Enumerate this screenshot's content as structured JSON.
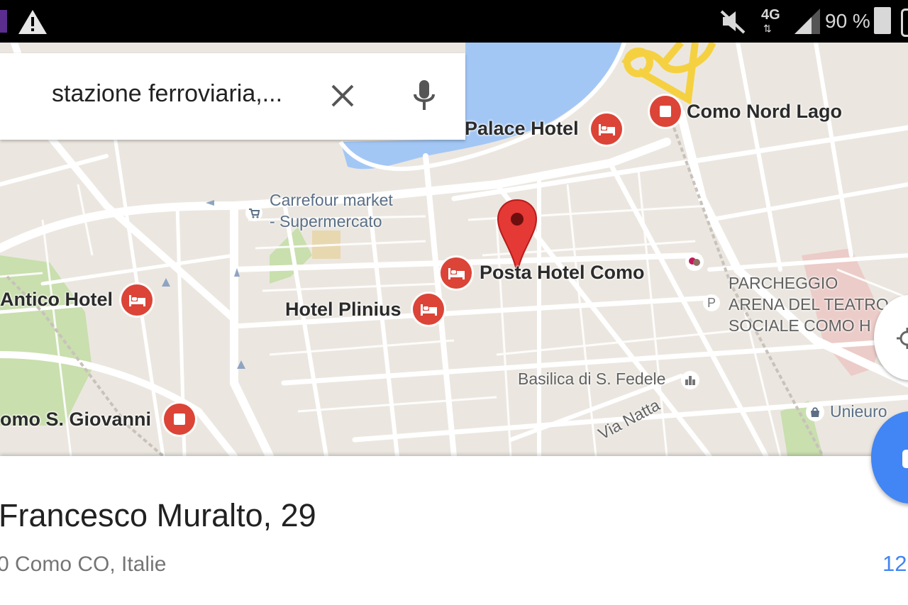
{
  "status_bar": {
    "network": "4G",
    "battery": "90 %",
    "icons": [
      "app-notification-icon",
      "warning-icon",
      "mute-icon",
      "signal-icon",
      "battery-icon"
    ]
  },
  "search": {
    "query": "stazione ferroviaria,...",
    "icons": [
      "close-icon",
      "mic-icon"
    ]
  },
  "map": {
    "pois": {
      "palace_hotel": "Palace Hotel",
      "como_nord_lago": "Como Nord Lago",
      "carrefour_line1": "Carrefour market",
      "carrefour_line2": "- Supermercato",
      "posta_hotel": "Posta Hotel Como",
      "antico_hotel": "Antico Hotel",
      "hotel_plinius": "Hotel Plinius",
      "parcheggio_line1": "PARCHEGGIO",
      "parcheggio_line2": "ARENA DEL TEATRO",
      "parcheggio_line3": "SOCIALE COMO H",
      "basilica": "Basilica di S. Fedele",
      "como_s_giovanni": "omo S. Giovanni",
      "unieuro": "Unieuro",
      "via_natta": "Via Natta",
      "parking_letter": "P"
    },
    "colors": {
      "land": "#ebe7e0",
      "water": "#a3c7f5",
      "road": "#ffffff",
      "park": "#c9dfae",
      "highway": "#f5d142",
      "marker": "#db4437",
      "accent": "#4285f4"
    }
  },
  "place": {
    "title": "Francesco Muralto, 29",
    "subtitle": "0 Como CO, Italie",
    "distance": "12"
  }
}
